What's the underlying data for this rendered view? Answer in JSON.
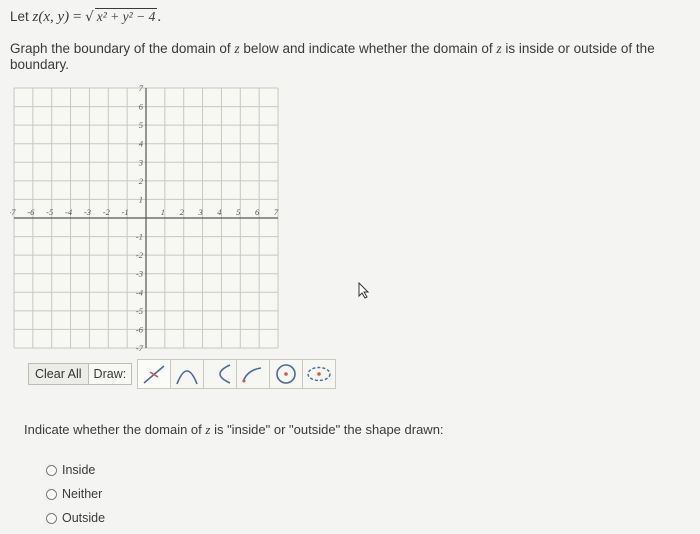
{
  "problem": {
    "prefix": "Let ",
    "function_lhs": "z(x, y)",
    "equals": " = ",
    "radicand": "x² + y² − 4",
    "suffix": "."
  },
  "instruction": {
    "part1": "Graph the boundary of the domain of ",
    "var1": "z",
    "part2": " below and indicate whether the domain of ",
    "var2": "z",
    "part3": " is inside or outside of the boundary."
  },
  "graph": {
    "x_min": -7,
    "x_max": 7,
    "y_min": -7,
    "y_max": 7,
    "x_tick_labels": [
      "-7",
      "-6",
      "-5",
      "-4",
      "-3",
      "-2",
      "-1",
      "1",
      "2",
      "3",
      "4",
      "5",
      "6",
      "7"
    ],
    "y_tick_labels": [
      "7",
      "6",
      "5",
      "4",
      "3",
      "2",
      "1",
      "-1",
      "-2",
      "-3",
      "-4",
      "-5",
      "-6",
      "-7"
    ],
    "grid_color": "#c8c8c0",
    "axis_color": "#555555"
  },
  "toolbar": {
    "clear_label": "Clear All",
    "draw_label": "Draw:"
  },
  "tools": [
    "line-tool",
    "parabola-tool",
    "hyperbola-tool",
    "ray-tool",
    "solid-circle-tool",
    "dashed-ellipse-tool"
  ],
  "question": {
    "part1": "Indicate whether the domain of ",
    "var": "z",
    "part2": " is \"inside\" or \"outside\" the shape drawn:"
  },
  "options": [
    {
      "label": "Inside"
    },
    {
      "label": "Neither"
    },
    {
      "label": "Outside"
    }
  ],
  "accent_red": "#d9534f",
  "accent_blue": "#4a6b9a"
}
